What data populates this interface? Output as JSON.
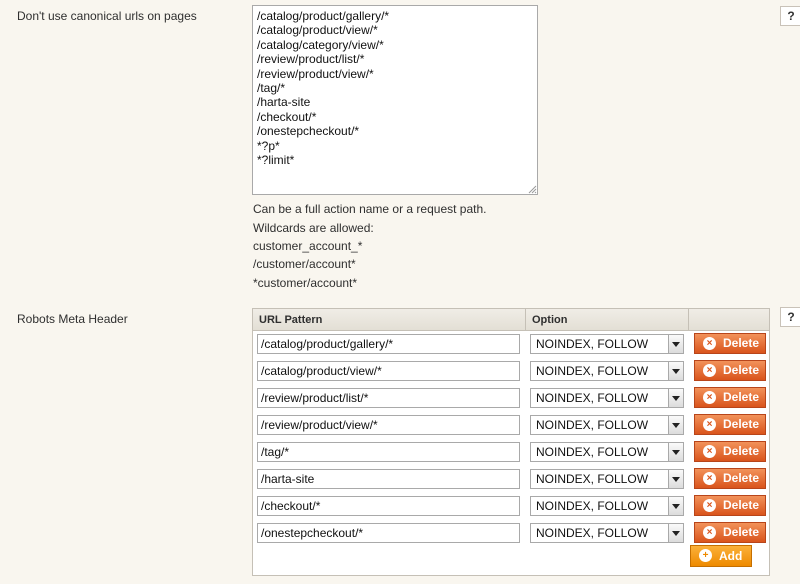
{
  "canonical": {
    "label": "Don't use canonical urls on pages",
    "lines": [
      {
        "text": "/catalog/product/gallery/*"
      },
      {
        "text": "/catalog/product/view/*"
      },
      {
        "text": "/catalog/category/view/*"
      },
      {
        "text": "/review/product/list/*"
      },
      {
        "text": "/review/product/view/*"
      },
      {
        "text": "/tag/*"
      },
      {
        "text": "/harta-site"
      },
      {
        "text": "/checkout/*"
      },
      {
        "text": "/onestepcheckout/*"
      },
      {
        "text": "*?p*"
      },
      {
        "text": "*?limit*"
      }
    ],
    "notes": [
      "Can be a full action name or a request path.",
      "Wildcards are allowed:",
      "customer_account_*",
      "/customer/account*",
      "*customer/account*"
    ],
    "help": "?"
  },
  "robots": {
    "label": "Robots Meta Header",
    "help": "?",
    "col_url": "URL Pattern",
    "col_option": "Option",
    "rows": [
      {
        "url": "/catalog/product/gallery/*",
        "option": "NOINDEX, FOLLOW"
      },
      {
        "url": "/catalog/product/view/*",
        "option": "NOINDEX, FOLLOW"
      },
      {
        "url": "/review/product/list/*",
        "option": "NOINDEX, FOLLOW"
      },
      {
        "url": "/review/product/view/*",
        "option": "NOINDEX, FOLLOW"
      },
      {
        "url": "/tag/*",
        "option": "NOINDEX, FOLLOW"
      },
      {
        "url": "/harta-site",
        "option": "NOINDEX, FOLLOW"
      },
      {
        "url": "/checkout/*",
        "option": "NOINDEX, FOLLOW"
      },
      {
        "url": "/onestepcheckout/*",
        "option": "NOINDEX, FOLLOW"
      }
    ],
    "delete_label": "Delete",
    "add_label": "Add"
  },
  "colors": {
    "delete": "#d9541c",
    "add": "#ee8a00",
    "background": "#f9f6ef"
  },
  "icons": {
    "delete": "delete-circle-icon",
    "add": "add-circle-icon",
    "help": "help-icon"
  }
}
